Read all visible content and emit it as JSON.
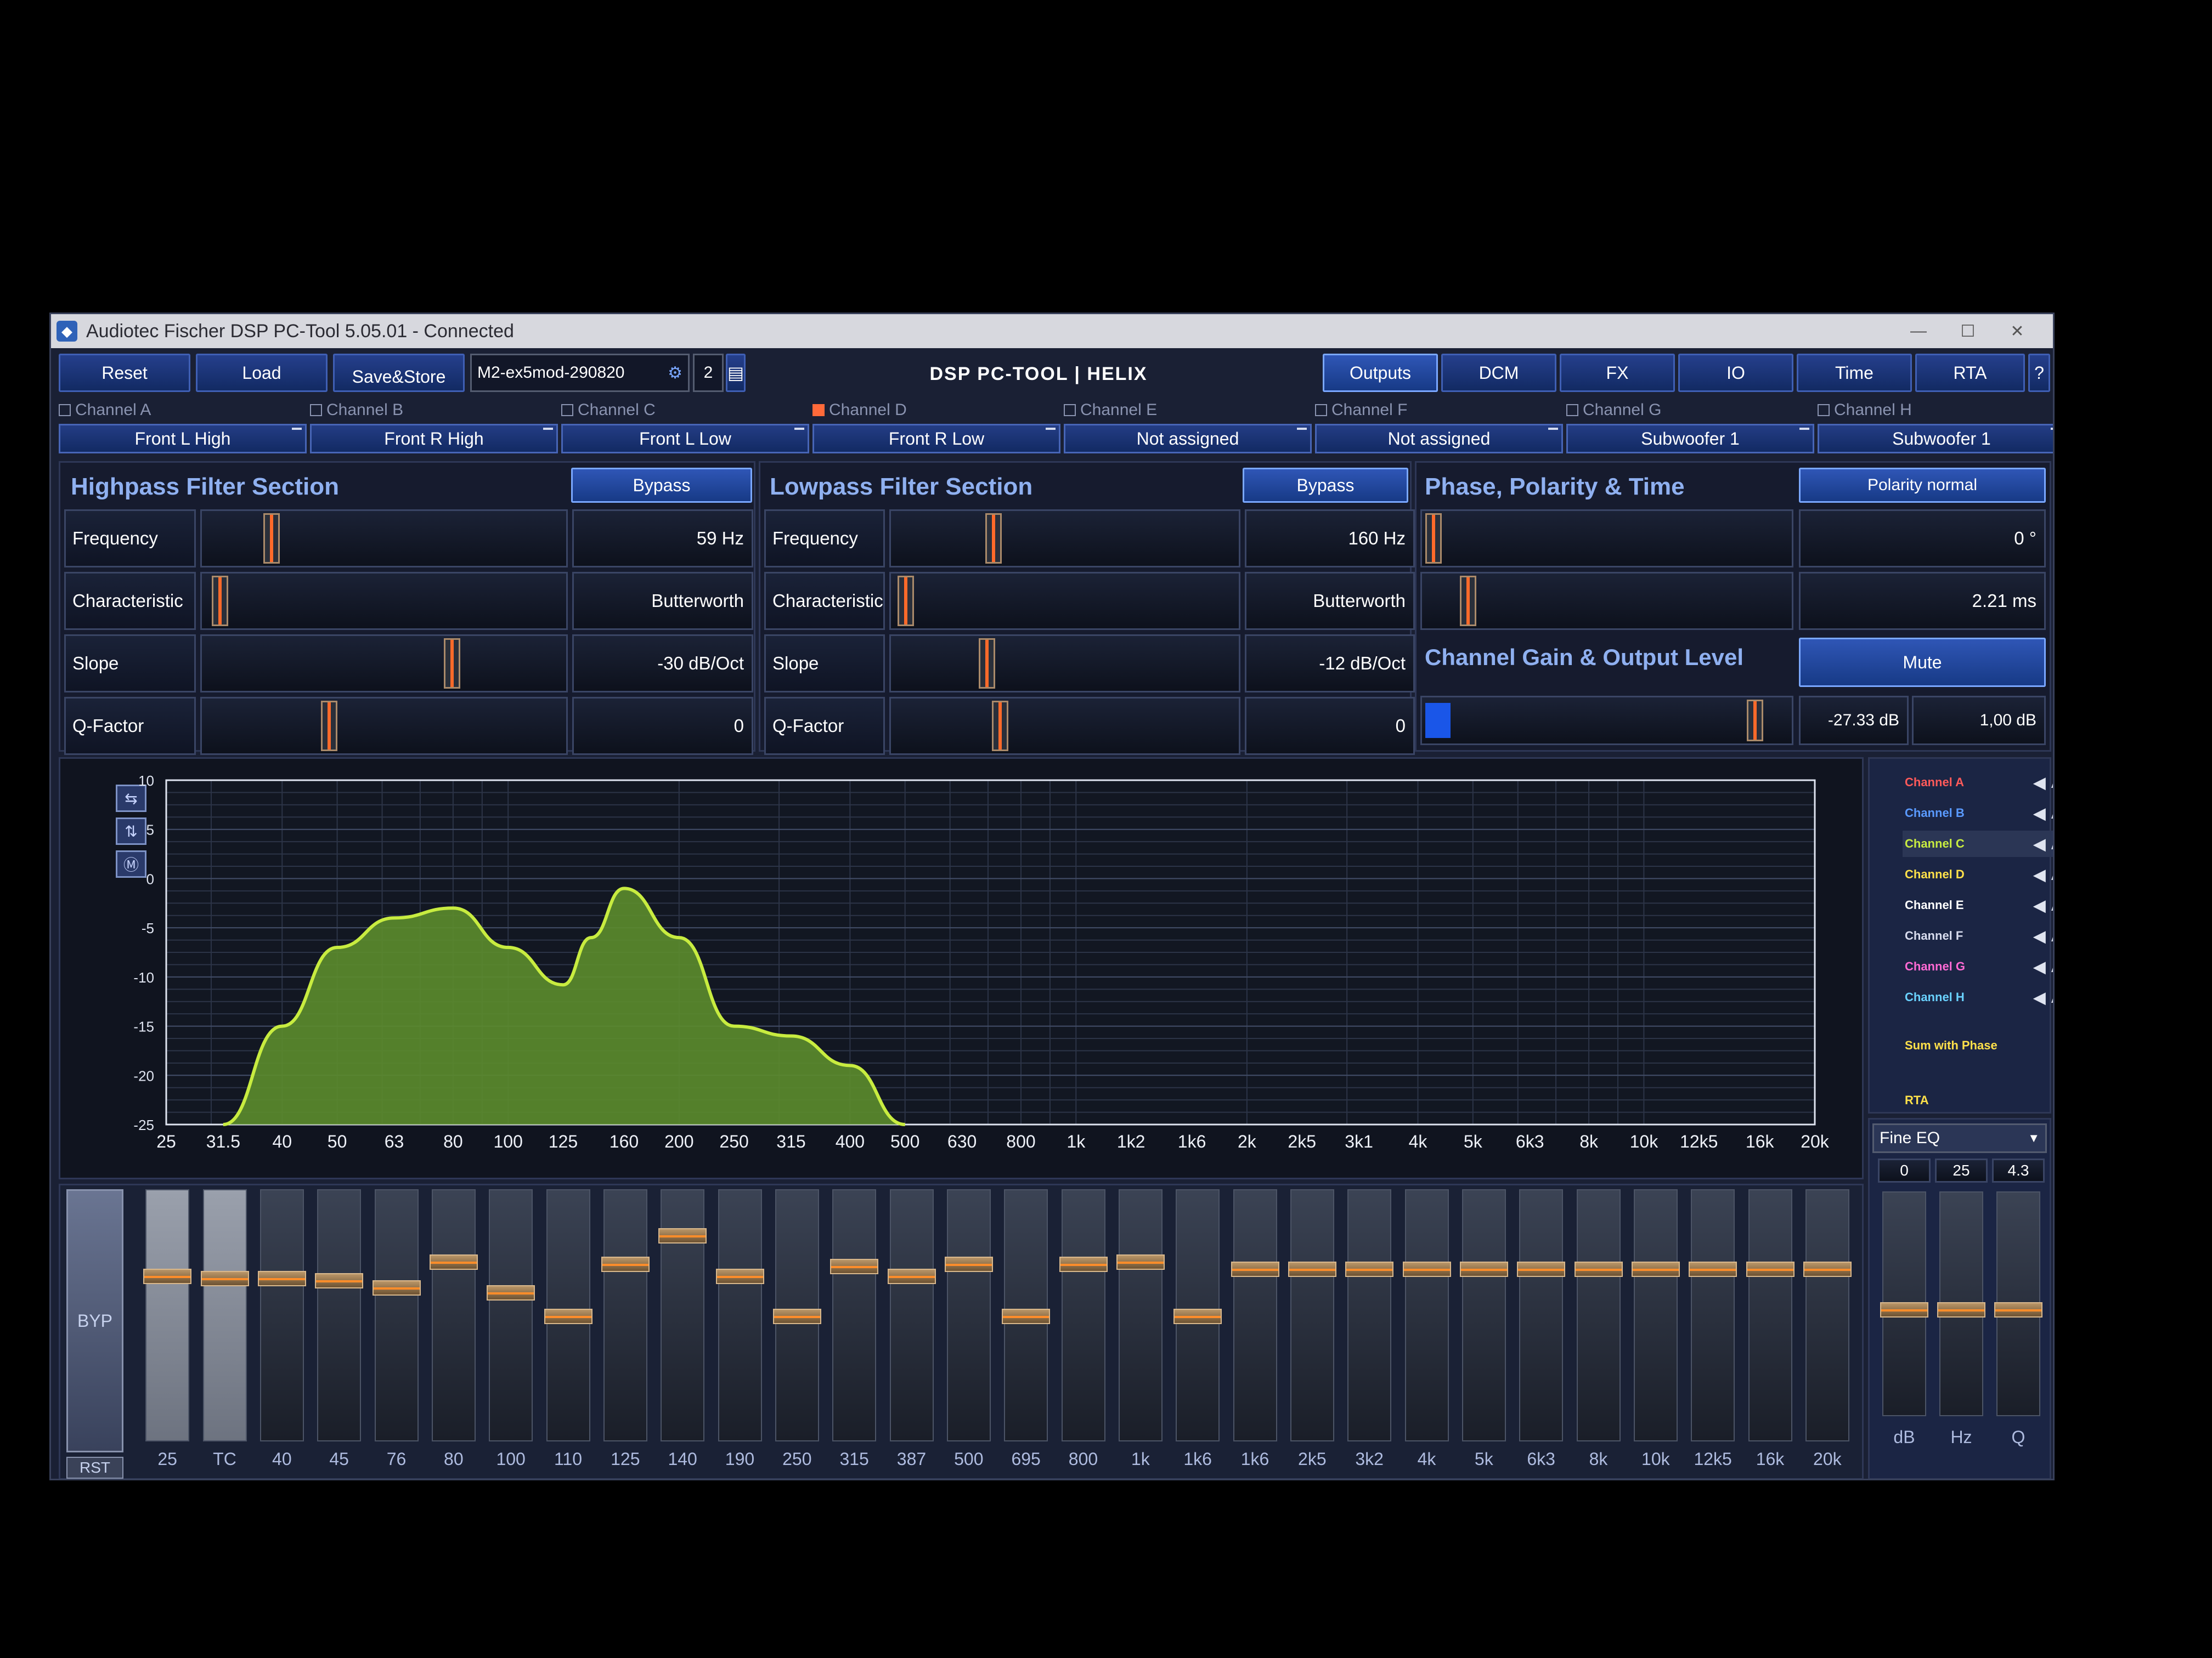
{
  "window": {
    "title": "Audiotec Fischer DSP PC-Tool 5.05.01 - Connected"
  },
  "toolbar": {
    "reset": "Reset",
    "load": "Load",
    "save_store": "Save&Store",
    "preset_name": "M2-ex5mod-290820",
    "preset_slot": "2",
    "logo": "DSP PC-TOOL | HELIX",
    "tabs": [
      "Outputs",
      "DCM",
      "FX",
      "IO",
      "Time",
      "RTA",
      "?"
    ]
  },
  "channels": [
    {
      "label": "Channel A",
      "assignment": "Front L High",
      "checked": false
    },
    {
      "label": "Channel B",
      "assignment": "Front R High",
      "checked": false
    },
    {
      "label": "Channel C",
      "assignment": "Front L Low",
      "checked": false
    },
    {
      "label": "Channel D",
      "assignment": "Front R Low",
      "checked": true
    },
    {
      "label": "Channel E",
      "assignment": "Not assigned",
      "checked": false
    },
    {
      "label": "Channel F",
      "assignment": "Not assigned",
      "checked": false
    },
    {
      "label": "Channel G",
      "assignment": "Subwoofer 1",
      "checked": false
    },
    {
      "label": "Channel H",
      "assignment": "Subwoofer 1",
      "checked": false
    }
  ],
  "highpass": {
    "title": "Highpass Filter Section",
    "bypass": "Bypass",
    "rows": [
      {
        "label": "Frequency",
        "value": "59 Hz",
        "pos": 0.17
      },
      {
        "label": "Characteristic",
        "value": "Butterworth",
        "pos": 0.02
      },
      {
        "label": "Slope",
        "value": "-30 dB/Oct",
        "pos": 0.7
      },
      {
        "label": "Q-Factor",
        "value": "0",
        "pos": 0.34
      }
    ]
  },
  "lowpass": {
    "title": "Lowpass Filter Section",
    "bypass": "Bypass",
    "rows": [
      {
        "label": "Frequency",
        "value": "160 Hz",
        "pos": 0.28
      },
      {
        "label": "Characteristic",
        "value": "Butterworth",
        "pos": 0.01
      },
      {
        "label": "Slope",
        "value": "-12 dB/Oct",
        "pos": 0.26
      },
      {
        "label": "Q-Factor",
        "value": "0",
        "pos": 0.3
      }
    ]
  },
  "phase": {
    "title": "Phase, Polarity & Time",
    "polarity": "Polarity normal",
    "phase_value": "0 °",
    "phase_pos": 0.0,
    "time_value": "2.21 ms",
    "time_pos": 0.1
  },
  "gain": {
    "title": "Channel Gain & Output Level",
    "mute": "Mute",
    "gain_value": "-27.33 dB",
    "gain_pos": 0.93,
    "level_value": "1,00 dB"
  },
  "chart_data": {
    "type": "area",
    "x_tick_labels": [
      "25",
      "31.5",
      "40",
      "50",
      "63",
      "80",
      "100",
      "125",
      "160",
      "200",
      "250",
      "315",
      "400",
      "500",
      "630",
      "800",
      "1k",
      "1k2",
      "1k6",
      "2k",
      "2k5",
      "3k1",
      "4k",
      "5k",
      "6k3",
      "8k",
      "10k",
      "12k5",
      "16k",
      "20k"
    ],
    "y_ticks": [
      10,
      5,
      0,
      -5,
      -10,
      -15,
      -20,
      -25
    ],
    "ylim": [
      -25,
      10
    ],
    "xlim": [
      25,
      20000
    ],
    "x_scale": "log",
    "series": [
      {
        "x": [
          31.5,
          40,
          50,
          63,
          80,
          100,
          125,
          140,
          160,
          200,
          250,
          315,
          400,
          500
        ],
        "y": [
          -25,
          -15,
          -7,
          -4,
          -3,
          -7,
          -10.8,
          -6,
          -1,
          -6,
          -15,
          -16,
          -19,
          -25
        ],
        "color": "#c8ec40"
      }
    ]
  },
  "legend": {
    "items": [
      {
        "label": "Channel A",
        "color": "#ff5a5a"
      },
      {
        "label": "Channel B",
        "color": "#5a9aff"
      },
      {
        "label": "Channel C",
        "color": "#c8ec40"
      },
      {
        "label": "Channel D",
        "color": "#ffe14a"
      },
      {
        "label": "Channel E",
        "color": "#ffffff"
      },
      {
        "label": "Channel F",
        "color": "#d9ddef"
      },
      {
        "label": "Channel G",
        "color": "#ff6ad5"
      },
      {
        "label": "Channel H",
        "color": "#6ad2ff"
      }
    ],
    "sum_label": "Sum with Phase",
    "rta_label": "RTA"
  },
  "eq": {
    "byp": "BYP",
    "rst": "RST",
    "bands": [
      {
        "label": "25",
        "level": 0.67
      },
      {
        "label": "TC",
        "level": 0.66
      },
      {
        "label": "40",
        "level": 0.66
      },
      {
        "label": "45",
        "level": 0.65
      },
      {
        "label": "76",
        "level": 0.62
      },
      {
        "label": "80",
        "level": 0.73
      },
      {
        "label": "100",
        "level": 0.6
      },
      {
        "label": "110",
        "level": 0.5
      },
      {
        "label": "125",
        "level": 0.72
      },
      {
        "label": "140",
        "level": 0.84
      },
      {
        "label": "190",
        "level": 0.67
      },
      {
        "label": "250",
        "level": 0.5
      },
      {
        "label": "315",
        "level": 0.71
      },
      {
        "label": "387",
        "level": 0.67
      },
      {
        "label": "500",
        "level": 0.72
      },
      {
        "label": "695",
        "level": 0.5
      },
      {
        "label": "800",
        "level": 0.72
      },
      {
        "label": "1k",
        "level": 0.73
      },
      {
        "label": "1k6",
        "level": 0.5
      },
      {
        "label": "1k6",
        "level": 0.7
      },
      {
        "label": "2k5",
        "level": 0.7
      },
      {
        "label": "3k2",
        "level": 0.7
      },
      {
        "label": "4k",
        "level": 0.7
      },
      {
        "label": "5k",
        "level": 0.7
      },
      {
        "label": "6k3",
        "level": 0.7
      },
      {
        "label": "8k",
        "level": 0.7
      },
      {
        "label": "10k",
        "level": 0.7
      },
      {
        "label": "12k5",
        "level": 0.7
      },
      {
        "label": "16k",
        "level": 0.7
      },
      {
        "label": "20k",
        "level": 0.7
      }
    ],
    "mode": "Fine EQ",
    "param_values": [
      "0",
      "25",
      "4.3"
    ],
    "param_labels": [
      "dB",
      "Hz",
      "Q"
    ]
  }
}
